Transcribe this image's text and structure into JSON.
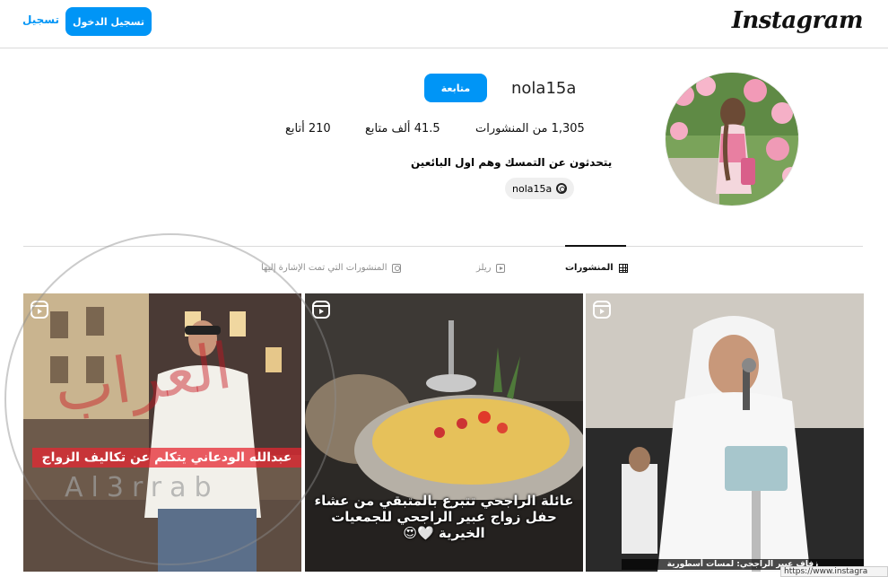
{
  "topbar": {
    "logo": "Instagram",
    "login_label": "تسجيل الدخول",
    "signup_label": "تسجيل"
  },
  "profile": {
    "username": "nola15a",
    "follow_label": "متابعة",
    "stats": {
      "posts": "1,305 من المنشورات",
      "followers": "41.5 ألف متابع",
      "following": "210 أتابع"
    },
    "bio": "يتحدثون عن التمسك وهم اول البائعين",
    "threads_handle": "nola15a"
  },
  "tabs": [
    {
      "label": "المنشورات",
      "icon": "grid-icon",
      "active": true
    },
    {
      "label": "ريلز",
      "icon": "reels-icon",
      "active": false
    },
    {
      "label": "المنشورات التي تمت الإشارة إليها",
      "icon": "tagged-icon",
      "active": false
    }
  ],
  "posts": [
    {
      "type": "reel",
      "caption": "عبدالله الودعاني يتكلم عن تكاليف الزواج"
    },
    {
      "type": "reel",
      "caption": "عائلة الراجحي تتبرع بالمتبقي من عشاء حفل زواج عبير الراجحي للجمعيات الخيرية 🤍😍"
    },
    {
      "type": "reel",
      "caption": "زفاف عبير الراجحي: لمسات أسطورية"
    }
  ],
  "watermark": {
    "arabic": "العراب",
    "latin": "Al3rrab"
  },
  "statusbar": {
    "url": "https://www.instagra"
  },
  "colors": {
    "accent": "#0095f6",
    "border": "#dbdbdb"
  }
}
